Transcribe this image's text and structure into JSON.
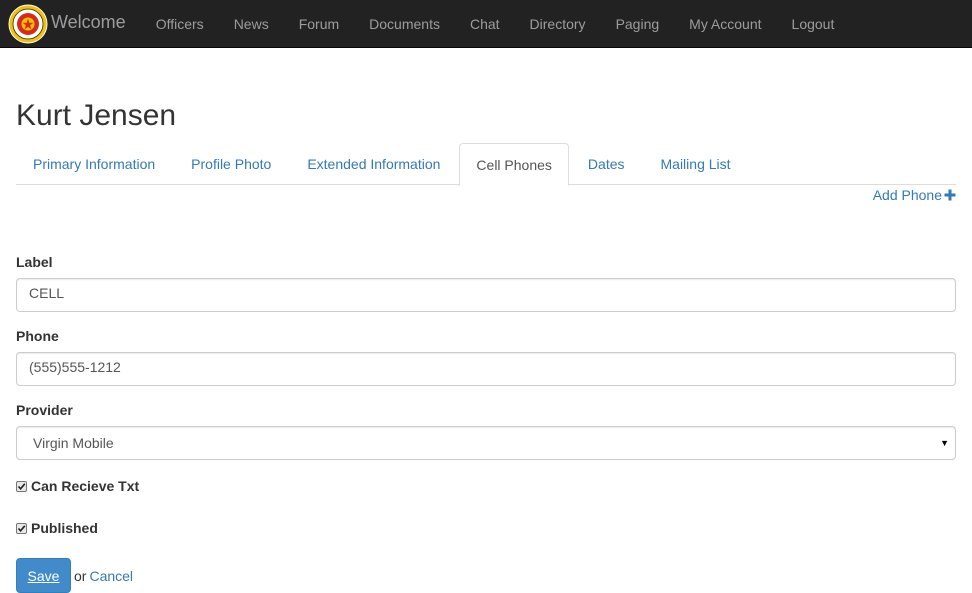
{
  "navbar": {
    "brand": "Welcome",
    "items": [
      "Officers",
      "News",
      "Forum",
      "Documents",
      "Chat",
      "Directory",
      "Paging",
      "My Account",
      "Logout"
    ]
  },
  "page": {
    "title": "Kurt Jensen"
  },
  "tabs": [
    {
      "label": "Primary Information",
      "active": false
    },
    {
      "label": "Profile Photo",
      "active": false
    },
    {
      "label": "Extended Information",
      "active": false
    },
    {
      "label": "Cell Phones",
      "active": true
    },
    {
      "label": "Dates",
      "active": false
    },
    {
      "label": "Mailing List",
      "active": false
    }
  ],
  "add_phone": {
    "label": "Add Phone"
  },
  "form": {
    "label_field": {
      "label": "Label",
      "value": "CELL"
    },
    "phone_field": {
      "label": "Phone",
      "value": "(555)555-1212"
    },
    "provider_field": {
      "label": "Provider",
      "value": "Virgin Mobile"
    },
    "can_receive_txt": {
      "label": "Can Recieve Txt",
      "checked": true
    },
    "published": {
      "label": "Published",
      "checked": true
    }
  },
  "actions": {
    "save": "Save",
    "or": "or",
    "cancel": "Cancel"
  },
  "colors": {
    "navbar_bg": "#222222",
    "link": "#337ab7",
    "primary_button": "#428bca"
  }
}
